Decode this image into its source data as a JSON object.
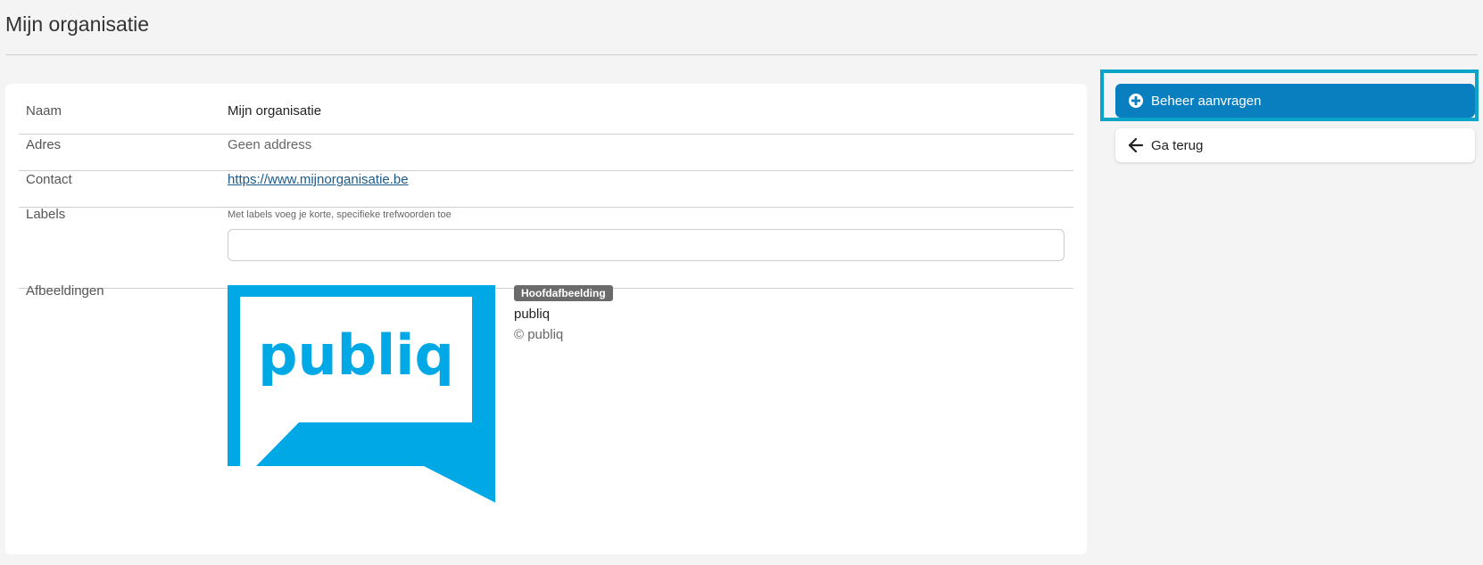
{
  "page": {
    "title": "Mijn organisatie"
  },
  "details": {
    "rows": [
      {
        "label": "Naam",
        "value": "Mijn organisatie"
      },
      {
        "label": "Adres",
        "value": "Geen address"
      },
      {
        "label": "Contact",
        "value": "https://www.mijnorganisatie.be"
      },
      {
        "label": "Labels",
        "hint": "Met labels voeg je korte, specifieke trefwoorden toe",
        "input_value": ""
      },
      {
        "label": "Afbeeldingen"
      }
    ]
  },
  "image": {
    "badge": "Hoofdafbeelding",
    "title": "publiq",
    "copyright": "© publiq",
    "logo_text": "publiq",
    "brand_color": "#00a9e6"
  },
  "actions": {
    "manage_label": "Beheer aanvragen",
    "manage_icon": "plus-circle-icon",
    "back_label": "Ga terug",
    "back_icon": "arrow-left-icon"
  },
  "colors": {
    "primary_button": "#0a7fbf",
    "highlight": "#0aa4c8",
    "link": "#1a5a8a"
  }
}
